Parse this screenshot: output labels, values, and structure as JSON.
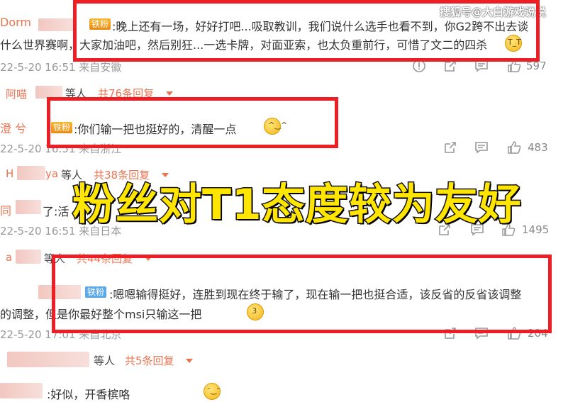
{
  "watermark": "搜狐号@大白游戏说说",
  "overlay_headline": "粉丝对T1态度较为友好",
  "comments": [
    {
      "username_visible": "Dorm",
      "badge": "铁粉",
      "text_line1": ":晚上还有一场，好好打吧...吸取教训，我们说什么选手也看不到，你G2跨不出去谈",
      "text_line2": "什么世界赛啊，大家加油吧，然后别狂...一选卡牌，对面亚索，也太负重前行，可惜了文二的四杀",
      "meta": "22-5-20 16:51 来自安徽",
      "likes": "597",
      "replies_prefix": "阿喵",
      "replies_waiting": "等人",
      "replies_count": "共76条回复"
    },
    {
      "username_visible": "澄 兮",
      "badge": "铁粉",
      "text": ":你们输一把也挺好的，清醒一点",
      "meta": "22-5-20 16:51 来自浙江",
      "likes": "483",
      "replies_prefix": "H",
      "replies_name_tail": "ya",
      "replies_waiting": "等人",
      "replies_count": "共38条回复"
    },
    {
      "username_visible": "同",
      "text": "了:活",
      "meta": "22-5-20 16:51 来自日本",
      "likes": "1495",
      "replies_prefix": "a",
      "replies_waiting": "等人",
      "replies_count": "共44条回复"
    },
    {
      "badge": "铁粉",
      "text_line1": ":嗯嗯输得挺好，连胜到现在终于输了，现在输一把也挺合适，该反省的反省该调整",
      "text_line2": "的调整，但是你最好整个msi只输这一把",
      "meta": "22-5-20 17:01 来自北京",
      "likes": "204",
      "replies_waiting": "等人",
      "replies_count": "共5条回复"
    },
    {
      "text": ":好似，开香槟咯"
    }
  ]
}
